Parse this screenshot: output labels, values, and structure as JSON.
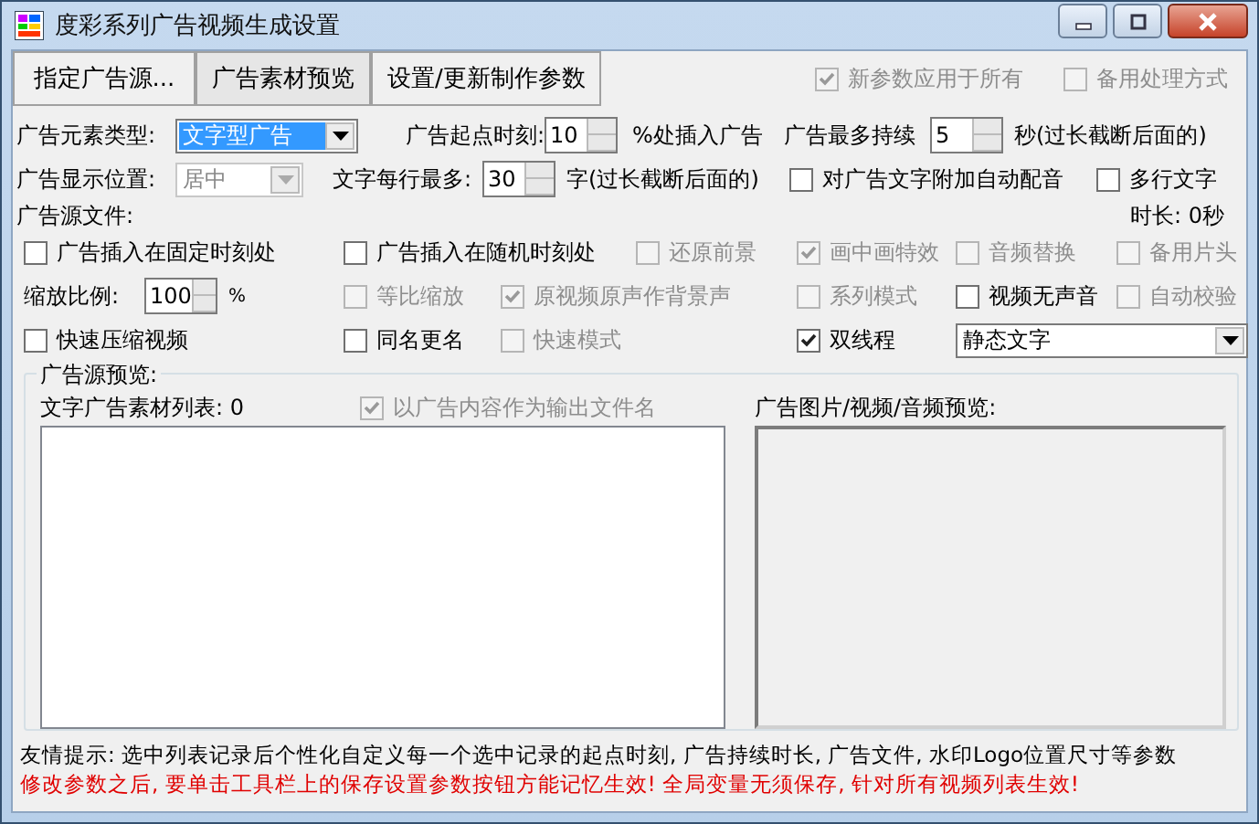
{
  "window": {
    "title": "度彩系列广告视频生成设置"
  },
  "toolbar": {
    "buttons": [
      "指定广告源...",
      "广告素材预览",
      "设置/更新制作参数"
    ],
    "options": [
      {
        "label": "新参数应用于所有",
        "checked": true,
        "disabled": true
      },
      {
        "label": "备用处理方式",
        "checked": false,
        "disabled": true
      }
    ]
  },
  "element_type": {
    "label": "广告元素类型:",
    "value": "文字型广告"
  },
  "start_time": {
    "label": "广告起点时刻:",
    "value": "10",
    "suffix": "%处插入广告"
  },
  "max_duration": {
    "label": "广告最多持续",
    "value": "5",
    "suffix": "秒(过长截断后面的)"
  },
  "position": {
    "label": "广告显示位置:",
    "value": "居中",
    "disabled": true
  },
  "chars_per_line": {
    "label": "文字每行最多:",
    "value": "30",
    "suffix": "字(过长截断后面的)"
  },
  "auto_voice": {
    "label": "对广告文字附加自动配音",
    "checked": false,
    "disabled": false
  },
  "multiline": {
    "label": "多行文字",
    "checked": false,
    "disabled": false
  },
  "source_label": "广告源文件:",
  "duration": "时长: 0秒",
  "option_rows": [
    [
      {
        "kind": "checkbox",
        "label": "广告插入在固定时刻处",
        "checked": false,
        "disabled": false
      },
      {
        "kind": "checkbox",
        "label": "广告插入在随机时刻处",
        "checked": false,
        "disabled": false
      },
      {
        "kind": "checkbox",
        "label": "还原前景",
        "checked": false,
        "disabled": true
      },
      {
        "kind": "checkbox",
        "label": "画中画特效",
        "checked": true,
        "disabled": true
      },
      {
        "kind": "checkbox",
        "label": "音频替换",
        "checked": false,
        "disabled": true
      },
      {
        "kind": "checkbox",
        "label": "备用片头",
        "checked": false,
        "disabled": true
      }
    ],
    [
      {
        "kind": "spin",
        "label": "缩放比例:",
        "value": "100",
        "suffix": "%"
      },
      {
        "kind": "checkbox",
        "label": "等比缩放",
        "checked": false,
        "disabled": true
      },
      {
        "kind": "checkbox",
        "label": "原视频原声作背景声",
        "checked": true,
        "disabled": true
      },
      {
        "kind": "checkbox",
        "label": "系列模式",
        "checked": false,
        "disabled": true
      },
      {
        "kind": "checkbox",
        "label": "视频无声音",
        "checked": false,
        "disabled": false
      },
      {
        "kind": "checkbox",
        "label": "自动校验",
        "checked": false,
        "disabled": true
      }
    ],
    [
      {
        "kind": "checkbox",
        "label": "快速压缩视频",
        "checked": false,
        "disabled": false
      },
      {
        "kind": "checkbox",
        "label": "同名更名",
        "checked": false,
        "disabled": false
      },
      {
        "kind": "checkbox",
        "label": "快速模式",
        "checked": false,
        "disabled": true
      },
      {
        "kind": "checkbox",
        "label": "双线程",
        "checked": true,
        "disabled": false
      },
      {
        "kind": "combo",
        "value": "静态文字"
      }
    ]
  ],
  "preview": {
    "title": "广告源预览:",
    "list_label": "文字广告素材列表: 0",
    "output_name": {
      "label": "以广告内容作为输出文件名",
      "checked": true,
      "disabled": true
    },
    "media_label": "广告图片/视频/音频预览:"
  },
  "hints": [
    {
      "text": "友情提示: 选中列表记录后个性化自定义每一个选中记录的起点时刻, 广告持续时长, 广告文件, 水印Logo位置尺寸等参数",
      "kind": "info"
    },
    {
      "text": "修改参数之后, 要单击工具栏上的保存设置参数按钮方能记忆生效! 全局变量无须保存, 针对所有视频列表生效!",
      "kind": "warning"
    }
  ]
}
